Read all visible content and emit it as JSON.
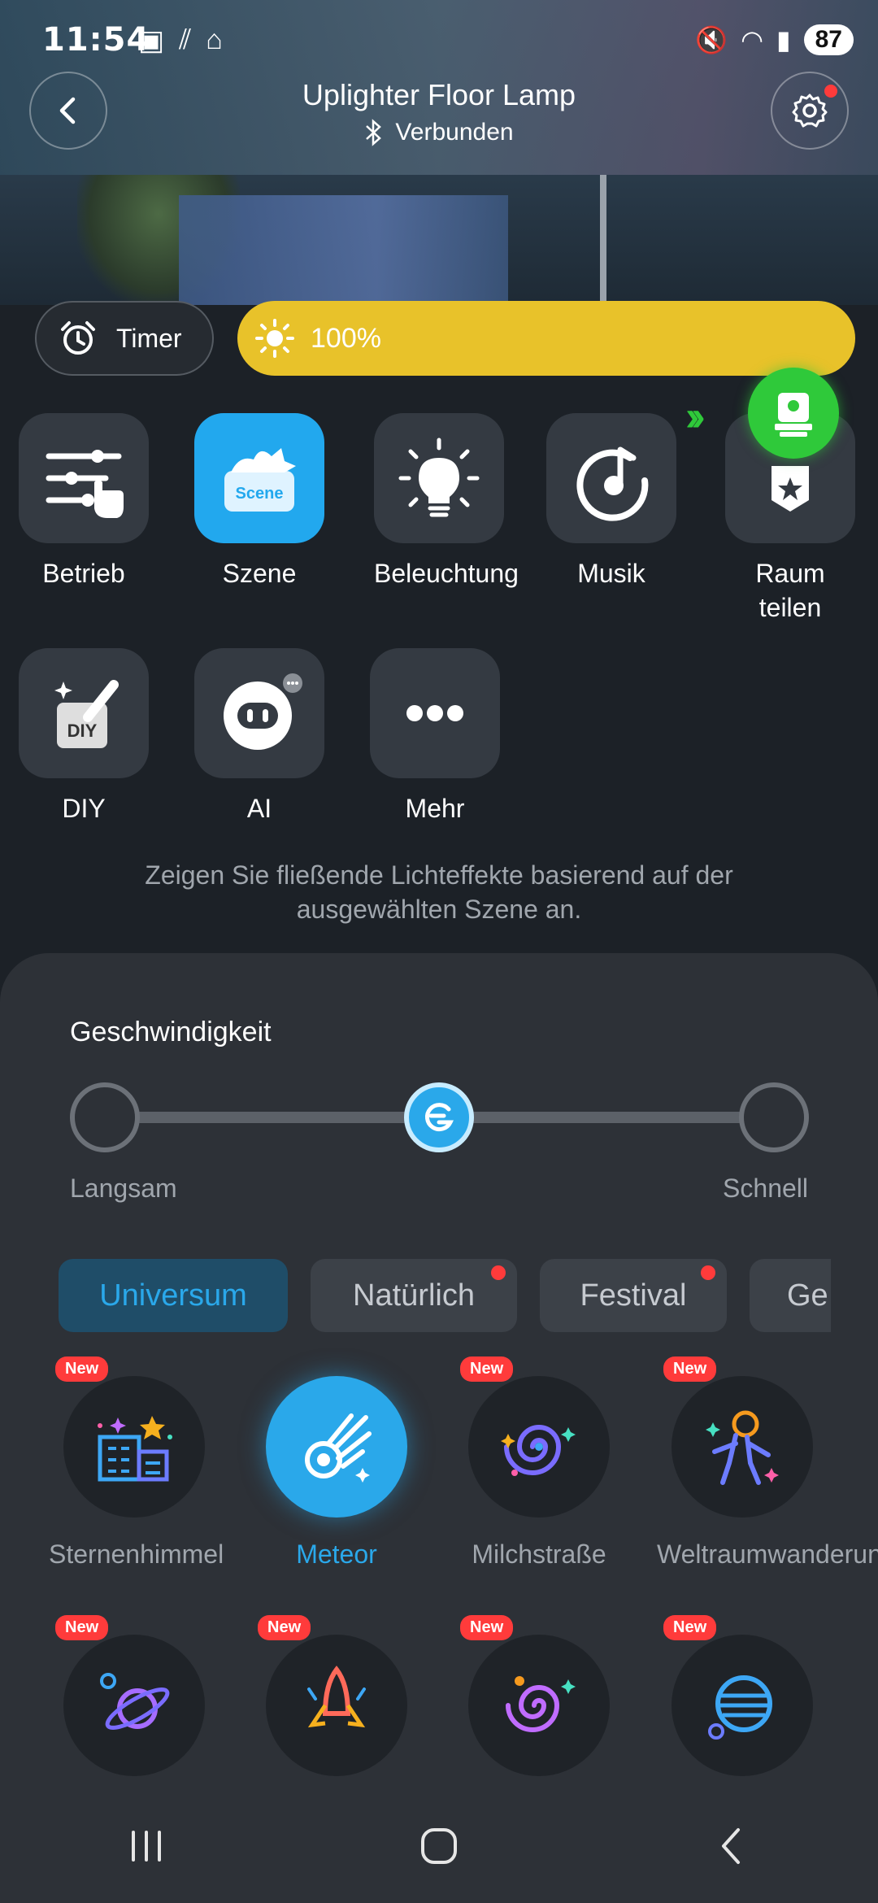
{
  "status_bar": {
    "time": "11:54",
    "battery": "87"
  },
  "header": {
    "title": "Uplighter Floor Lamp",
    "connection": "Verbunden"
  },
  "controls": {
    "timer_label": "Timer",
    "brightness": "100%"
  },
  "functions": [
    {
      "label": "Betrieb"
    },
    {
      "label": "Szene",
      "tile_text": "Scene"
    },
    {
      "label": "Beleuchtung"
    },
    {
      "label": "Musik"
    },
    {
      "label": "Raum teilen"
    },
    {
      "label": "DIY",
      "tile_text": "DIY"
    },
    {
      "label": "AI"
    },
    {
      "label": "Mehr"
    }
  ],
  "description": "Zeigen Sie fließende Lichteffekte basierend auf der ausgewählten Szene an.",
  "speed": {
    "title": "Geschwindigkeit",
    "slow": "Langsam",
    "fast": "Schnell",
    "level": 0.5
  },
  "categories": [
    {
      "label": "Universum",
      "selected": true
    },
    {
      "label": "Natürlich",
      "dot": true
    },
    {
      "label": "Festival",
      "dot": true
    },
    {
      "label": "Ge"
    }
  ],
  "badge_new": "New",
  "scenes": [
    {
      "label": "Sternenhimmel",
      "new": true
    },
    {
      "label": "Meteor",
      "selected": true
    },
    {
      "label": "Milchstraße",
      "new": true
    },
    {
      "label": "Weltraumwanderung",
      "new": true
    },
    {
      "label": "",
      "new": true
    },
    {
      "label": "",
      "new": true
    },
    {
      "label": "",
      "new": true
    },
    {
      "label": "",
      "new": true
    }
  ],
  "colors": {
    "accent": "#2aa8ea",
    "brightness_bar": "#e8c22a",
    "fab": "#2fc93a",
    "badge": "#ff3b3b"
  }
}
